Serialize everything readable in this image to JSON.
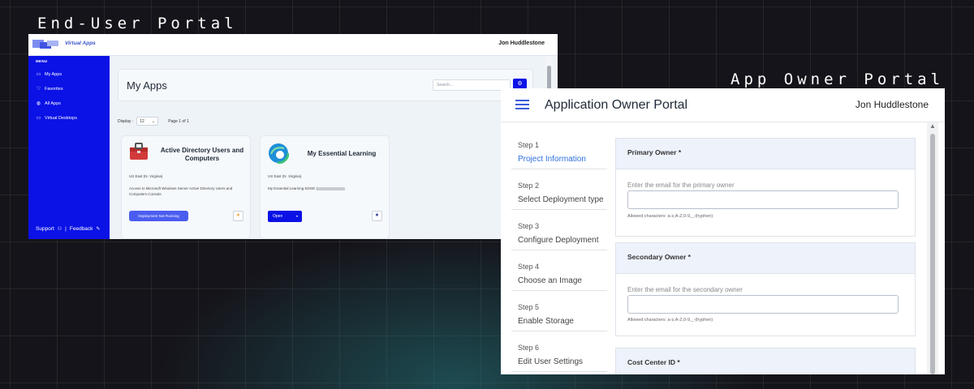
{
  "captions": {
    "end_user": "End-User Portal",
    "app_owner": "App Owner Portal"
  },
  "end_user_portal": {
    "brand": "Virtual Apps",
    "user": "Jon Huddlestone",
    "sidebar": {
      "menu_heading": "MENU",
      "items": [
        {
          "label": "My Apps",
          "icon": "monitor-icon"
        },
        {
          "label": "Favorites",
          "icon": "heart-icon"
        },
        {
          "label": "All Apps",
          "icon": "grid-icon"
        },
        {
          "label": "Virtual Desktops",
          "icon": "desktop-icon"
        }
      ],
      "support": "Support",
      "divider": "|",
      "feedback": "Feedback"
    },
    "page_title": "My Apps",
    "search_placeholder": "Search...",
    "display_label": "Display :",
    "display_value": "12",
    "page_info": "Page 1 of 1",
    "cards": [
      {
        "name": "Active Directory Users and Computers",
        "region": "US East (N. Virginia)",
        "description": "Access to Microsoft Windows Server Active Directory Users and Computers Console",
        "button": "Deployment Not Running",
        "favorite": "★"
      },
      {
        "name": "My Essential Learning",
        "region": "US East (N. Virginia)",
        "description": "My Essential Learning EDGE (",
        "button": "Open",
        "favorite": "★"
      }
    ],
    "colors": {
      "sidebar": "#0a12e6",
      "primary": "#0a12e6",
      "fav_active": "#f4a03a"
    }
  },
  "app_owner_portal": {
    "title": "Application Owner Portal",
    "user": "Jon Huddlestone",
    "steps": [
      {
        "number": "Step 1",
        "title": "Project Information",
        "active": true
      },
      {
        "number": "Step 2",
        "title": "Select Deployment type"
      },
      {
        "number": "Step 3",
        "title": "Configure Deployment"
      },
      {
        "number": "Step 4",
        "title": "Choose an Image"
      },
      {
        "number": "Step 5",
        "title": "Enable Storage"
      },
      {
        "number": "Step 6",
        "title": "Edit User Settings"
      }
    ],
    "sections": [
      {
        "header": "Primary Owner *",
        "label": "Enter the email for the primary owner",
        "value": "",
        "help": "Allowed characters: a-z,A-Z,0-9,_-(hyphen)"
      },
      {
        "header": "Secondary Owner *",
        "label": "Enter the email for the secondary owner",
        "value": "",
        "help": "Allowed characters: a-z,A-Z,0-9,_-(hyphen)"
      },
      {
        "header": "Cost Center ID *"
      }
    ],
    "colors": {
      "accent": "#2f6fdd",
      "section_header": "#edf2fb"
    }
  }
}
